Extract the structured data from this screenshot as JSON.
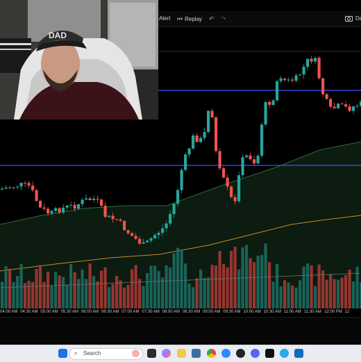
{
  "toolbar": {
    "alert_label": "Alert",
    "replay_label": "Replay",
    "undo_icon": "undo-icon",
    "redo_icon": "redo-icon",
    "camera_icon": "camera-icon",
    "right_label": "Da"
  },
  "time_axis": {
    "ticks": [
      "04:00 AM",
      "04:30 AM",
      "05:00 AM",
      "05:30 AM",
      "06:00 AM",
      "06:30 AM",
      "07:00 AM",
      "07:30 AM",
      "08:00 AM",
      "08:30 AM",
      "09:00 AM",
      "09:30 AM",
      "10:00 AM",
      "10:30 AM",
      "11:00 AM",
      "11:30 AM",
      "12:00 PM",
      "12"
    ]
  },
  "taskbar": {
    "search_placeholder": "Search",
    "apps": [
      "start-icon",
      "search-icon",
      "task-view-icon",
      "copilot-icon",
      "file-explorer-icon",
      "store-icon",
      "chrome-icon",
      "zoom-icon",
      "obs-icon",
      "discord-icon",
      "tradingview-icon",
      "telegram-icon",
      "outlook-icon"
    ]
  },
  "colors": {
    "bull": "#26a69a",
    "bear": "#ef5350",
    "horizontal_line": "#3f51ff",
    "ma_green": "#2f6b3a",
    "ma_orange": "#c98a2b",
    "background": "#000000"
  },
  "webcam": {
    "cap_text": "DAD"
  }
}
